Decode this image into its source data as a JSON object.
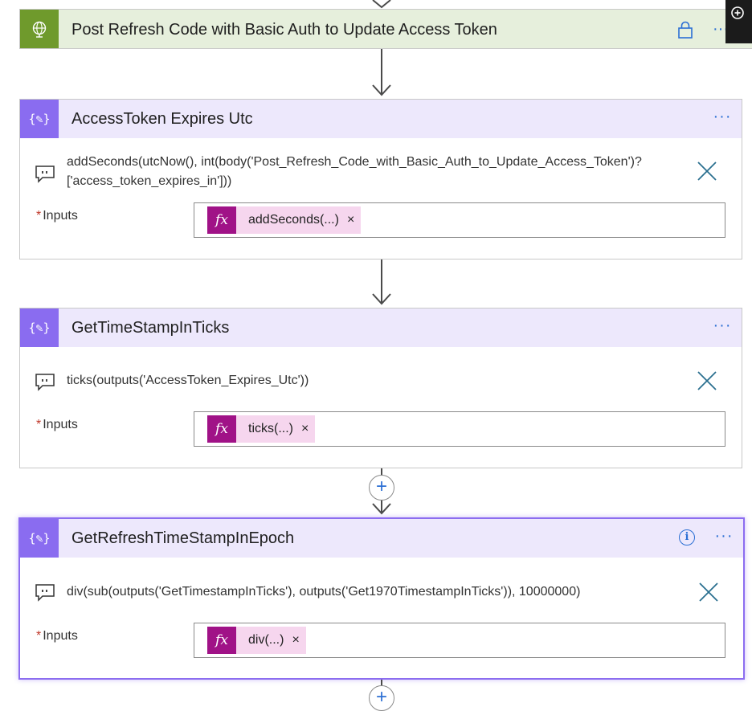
{
  "top_action": {
    "title": "Post Refresh Code with Basic Auth to Update Access Token",
    "icon": "globe-icon",
    "lock_icon": "lock-icon",
    "more": "···",
    "accent": "#6f9a2c",
    "header_bg": "#e6efdc"
  },
  "cards": [
    {
      "title": "AccessToken Expires Utc",
      "expression": "addSeconds(utcNow(), int(body('Post_Refresh_Code_with_Basic_Auth_to_Update_Access_Token')?['access_token_expires_in']))",
      "expression_line1": "addSeconds(utcNow(), int(body('Post_Refresh_Code_with_Basic_Auth_to_Update_Access_Token')?",
      "expression_line2": "['access_token_expires_in']))",
      "inputs_label": "Inputs",
      "required_mark": "*",
      "token_fx": "fx",
      "token_label": "addSeconds(...)",
      "token_remove": "×",
      "more": "···"
    },
    {
      "title": "GetTimeStampInTicks",
      "expression": "ticks(outputs('AccessToken_Expires_Utc'))",
      "inputs_label": "Inputs",
      "required_mark": "*",
      "token_fx": "fx",
      "token_label": "ticks(...)",
      "token_remove": "×",
      "more": "···"
    },
    {
      "title": "GetRefreshTimeStampInEpoch",
      "expression": "div(sub(outputs('GetTimestampInTicks'), outputs('Get1970TimestampInTicks')), 10000000)",
      "inputs_label": "Inputs",
      "required_mark": "*",
      "token_fx": "fx",
      "token_label": "div(...)",
      "token_remove": "×",
      "more": "···",
      "info": "i",
      "selected": true
    }
  ],
  "insert_step": "+",
  "colors": {
    "compose_accent": "#8a6cf0",
    "compose_header_bg": "#ede8fc",
    "fx_token": "#a01287",
    "token_bg": "#f6d6ee",
    "link_blue": "#2b6fd4"
  }
}
